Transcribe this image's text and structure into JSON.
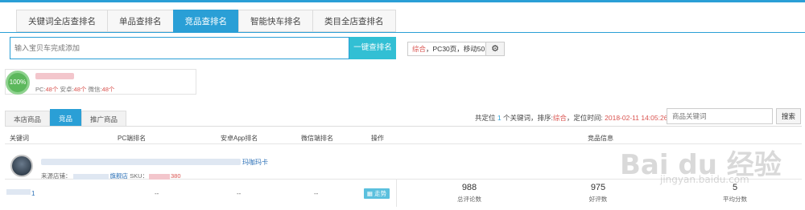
{
  "main_tabs": [
    {
      "label": "关键词全店查排名",
      "active": false
    },
    {
      "label": "单品查排名",
      "active": false
    },
    {
      "label": "竞品查排名",
      "active": true
    },
    {
      "label": "智能快车排名",
      "active": false
    },
    {
      "label": "类目全店查排名",
      "active": false
    }
  ],
  "search": {
    "placeholder": "输入宝贝车完成添加",
    "button_label": "一键查排名",
    "mode_label": "综合",
    "pages_text": "，PC30页，移动50页"
  },
  "summary": {
    "percent": "100%",
    "pc_label": "PC:",
    "pc_count": "48个",
    "android_label": "安卓:",
    "android_count": "48个",
    "wechat_label": "微信:",
    "wechat_count": "48个"
  },
  "sub_tabs": [
    {
      "label": "本店商品",
      "active": false
    },
    {
      "label": "竞品",
      "active": true
    },
    {
      "label": "推广商品",
      "active": false
    }
  ],
  "locate": {
    "prefix": "共定位",
    "count": "1",
    "middle": "个关键词，排序:",
    "sort": "综合",
    "time_label": "，定位时间:",
    "time": "2018-02-11 14:05:26"
  },
  "keyword_filter": {
    "placeholder": "商品关键词",
    "button_label": "搜索"
  },
  "table": {
    "headers": [
      "关键词",
      "PC端排名",
      "安卓App排名",
      "微信端排名",
      "操作",
      "竞品信息"
    ],
    "product": {
      "title_tail": "玛咖玛卡",
      "source_label": "来源店铺：",
      "store_suffix": "旗舰店",
      "sku_label": "SKU：",
      "sku_tail": "380"
    },
    "rank_row": {
      "keyword_tail": "1",
      "pc": "--",
      "android": "--",
      "wechat": "--",
      "trend_label": "走势"
    },
    "metrics": [
      {
        "value": "988",
        "label": "总评论数"
      },
      {
        "value": "975",
        "label": "好评数"
      },
      {
        "value": "5",
        "label": "平均分数"
      }
    ]
  },
  "watermark": {
    "brand": "Bai du 经验",
    "url": "jingyan.baidu.com"
  },
  "colors": {
    "accent": "#2a9fd6",
    "button": "#32bfd4",
    "success": "#5cb85c",
    "danger": "#d9534f"
  }
}
